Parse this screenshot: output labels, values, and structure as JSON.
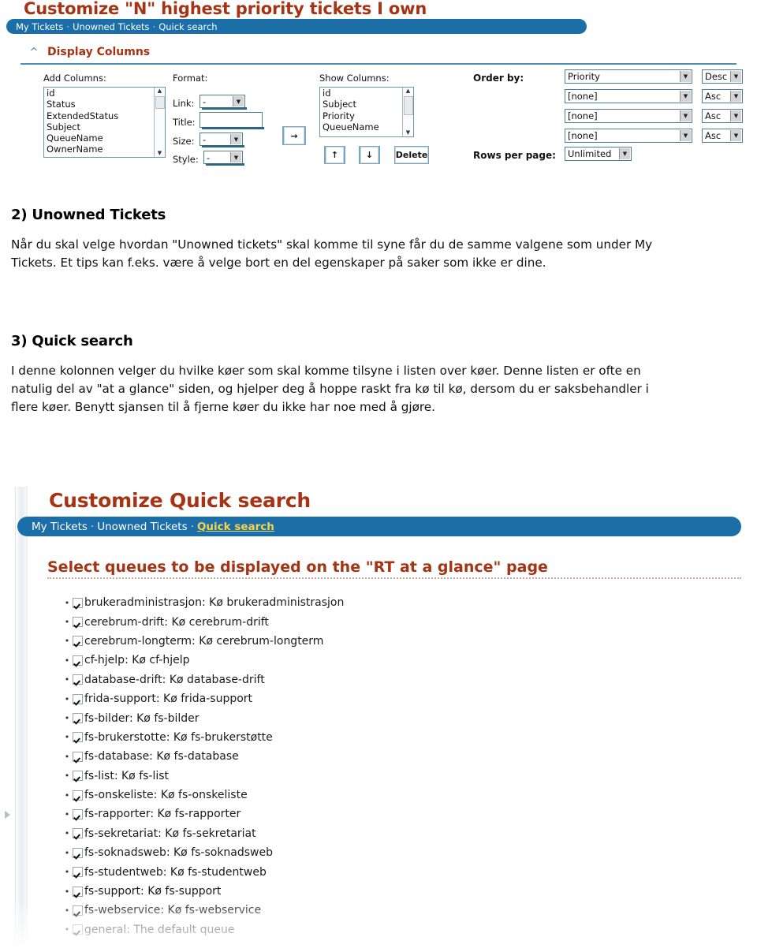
{
  "screenshot1": {
    "page_title": "Customize \"N\" highest priority tickets I own",
    "breadcrumbs": [
      {
        "label": "My Tickets",
        "active": false
      },
      {
        "label": "Unowned Tickets",
        "active": false
      },
      {
        "label": "Quick search",
        "active": false
      }
    ],
    "separator": "·",
    "section": {
      "caret_icon": "chevron-up-icon",
      "title": "Display Columns"
    },
    "add_columns": {
      "label": "Add Columns:",
      "options": [
        "id",
        "Status",
        "ExtendedStatus",
        "Subject",
        "QueueName",
        "OwnerName"
      ]
    },
    "format": {
      "label": "Format:",
      "link_label": "Link:",
      "link_value": "-",
      "title_label": "Title:",
      "title_value": "",
      "size_label": "Size:",
      "size_value": "-",
      "style_label": "Style:",
      "style_value": "-"
    },
    "add_button": "→",
    "show_columns": {
      "label": "Show Columns:",
      "options": [
        "id",
        "Subject",
        "Priority",
        "QueueName"
      ]
    },
    "list_buttons": {
      "up": "↑",
      "down": "↓",
      "delete": "Delete"
    },
    "order_by": {
      "label": "Order by:",
      "rows": [
        {
          "field": "Priority",
          "direction": "Desc"
        },
        {
          "field": "[none]",
          "direction": "Asc"
        },
        {
          "field": "[none]",
          "direction": "Asc"
        },
        {
          "field": "[none]",
          "direction": "Asc"
        }
      ]
    },
    "rows_per_page": {
      "label": "Rows per page:",
      "value": "Unlimited"
    }
  },
  "body_text": {
    "heading_2": "2) Unowned Tickets",
    "paragraph_2": "Når du skal velge hvordan \"Unowned tickets\" skal komme til syne får du de samme valgene som under My Tickets. Et tips kan f.eks. være å velge bort en del egenskaper på saker som ikke er dine.",
    "heading_3": "3) Quick search",
    "paragraph_3": "I denne kolonnen velger du hvilke køer som skal komme tilsyne i listen over køer. Denne listen er ofte en natulig del av \"at a glance\" siden, og hjelper deg å hoppe raskt fra kø til kø, dersom du er saksbehandler i flere køer. Benytt sjansen til å fjerne køer du ikke har noe med å gjøre."
  },
  "screenshot2": {
    "page_title": "Customize Quick search",
    "breadcrumbs": [
      {
        "label": "My Tickets",
        "active": false
      },
      {
        "label": "Unowned Tickets",
        "active": false
      },
      {
        "label": "Quick search",
        "active": true
      }
    ],
    "separator": "·",
    "select_heading": "Select queues to be displayed on the \"RT at a glance\" page",
    "queues": [
      {
        "label": "brukeradministrasjon: Kø brukeradministrasjon",
        "checked": true
      },
      {
        "label": "cerebrum-drift: Kø cerebrum-drift",
        "checked": true
      },
      {
        "label": "cerebrum-longterm: Kø cerebrum-longterm",
        "checked": true
      },
      {
        "label": "cf-hjelp: Kø cf-hjelp",
        "checked": true
      },
      {
        "label": "database-drift: Kø database-drift",
        "checked": true
      },
      {
        "label": "frida-support: Kø frida-support",
        "checked": true
      },
      {
        "label": "fs-bilder: Kø fs-bilder",
        "checked": true
      },
      {
        "label": "fs-brukerstotte: Kø fs-brukerstøtte",
        "checked": true
      },
      {
        "label": "fs-database: Kø fs-database",
        "checked": true
      },
      {
        "label": "fs-list: Kø fs-list",
        "checked": true
      },
      {
        "label": "fs-onskeliste: Kø fs-onskeliste",
        "checked": true
      },
      {
        "label": "fs-rapporter: Kø fs-rapporter",
        "checked": true
      },
      {
        "label": "fs-sekretariat: Kø fs-sekretariat",
        "checked": true
      },
      {
        "label": "fs-soknadsweb: Kø fs-soknadsweb",
        "checked": true
      },
      {
        "label": "fs-studentweb: Kø fs-studentweb",
        "checked": true
      },
      {
        "label": "fs-support: Kø fs-support",
        "checked": true
      },
      {
        "label": "fs-webservice: Kø fs-webservice",
        "checked": true
      },
      {
        "label": "general: The default queue",
        "checked": true
      }
    ],
    "bullet": "•"
  },
  "colors": {
    "title_red": "#A53314",
    "bar_blue": "#1C6EA8",
    "active_crumb": "#F4D44C",
    "control_border": "#4E7E99",
    "section_rule": "#4B8FB5"
  }
}
